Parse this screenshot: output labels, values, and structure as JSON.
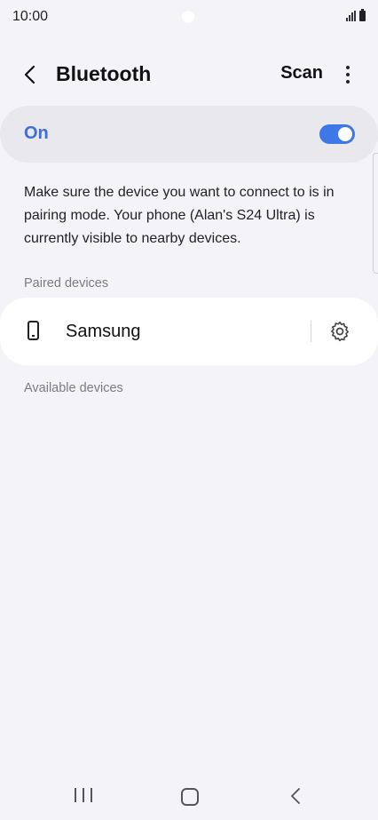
{
  "status_bar": {
    "time": "10:00"
  },
  "header": {
    "title": "Bluetooth",
    "scan_label": "Scan",
    "back_icon": "chevron-left-icon",
    "more_icon": "more-vertical-icon"
  },
  "toggle": {
    "label": "On",
    "state": "on",
    "accent_color": "#3e78e6"
  },
  "description": "Make sure the device you want to connect to is in pairing mode. Your phone (Alan's S24 Ultra) is currently visible to nearby devices.",
  "paired_devices": {
    "header": "Paired devices",
    "items": [
      {
        "name": "Samsung",
        "icon": "phone-icon",
        "action_icon": "gear-icon"
      }
    ]
  },
  "available_devices": {
    "header": "Available devices"
  },
  "nav_bar": {
    "icons": [
      "recents-icon",
      "home-icon",
      "back-icon"
    ]
  }
}
